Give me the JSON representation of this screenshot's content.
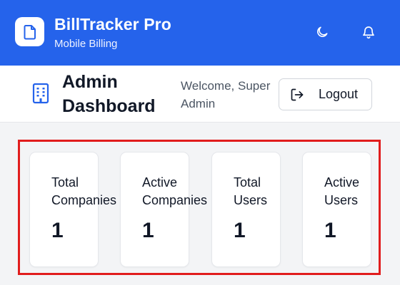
{
  "header": {
    "title": "BillTracker Pro",
    "subtitle": "Mobile Billing",
    "icons": {
      "logo": "document-icon",
      "theme": "moon-icon",
      "notifications": "bell-icon"
    },
    "background_color": "#2563eb"
  },
  "admin": {
    "title": "Admin Dashboard",
    "welcome": "Welcome, Super Admin",
    "logout_label": "Logout",
    "icon": "building-icon",
    "accent_color": "#2563eb"
  },
  "stats": [
    {
      "label_line1": "Total",
      "label_line2": "Companies",
      "value": "1"
    },
    {
      "label_line1": "Active",
      "label_line2": "Companies",
      "value": "1"
    },
    {
      "label_line1": "Total",
      "label_line2": "Users",
      "value": "1"
    },
    {
      "label_line1": "Active",
      "label_line2": "Users",
      "value": "1"
    }
  ],
  "highlight_color": "#e11d1d"
}
